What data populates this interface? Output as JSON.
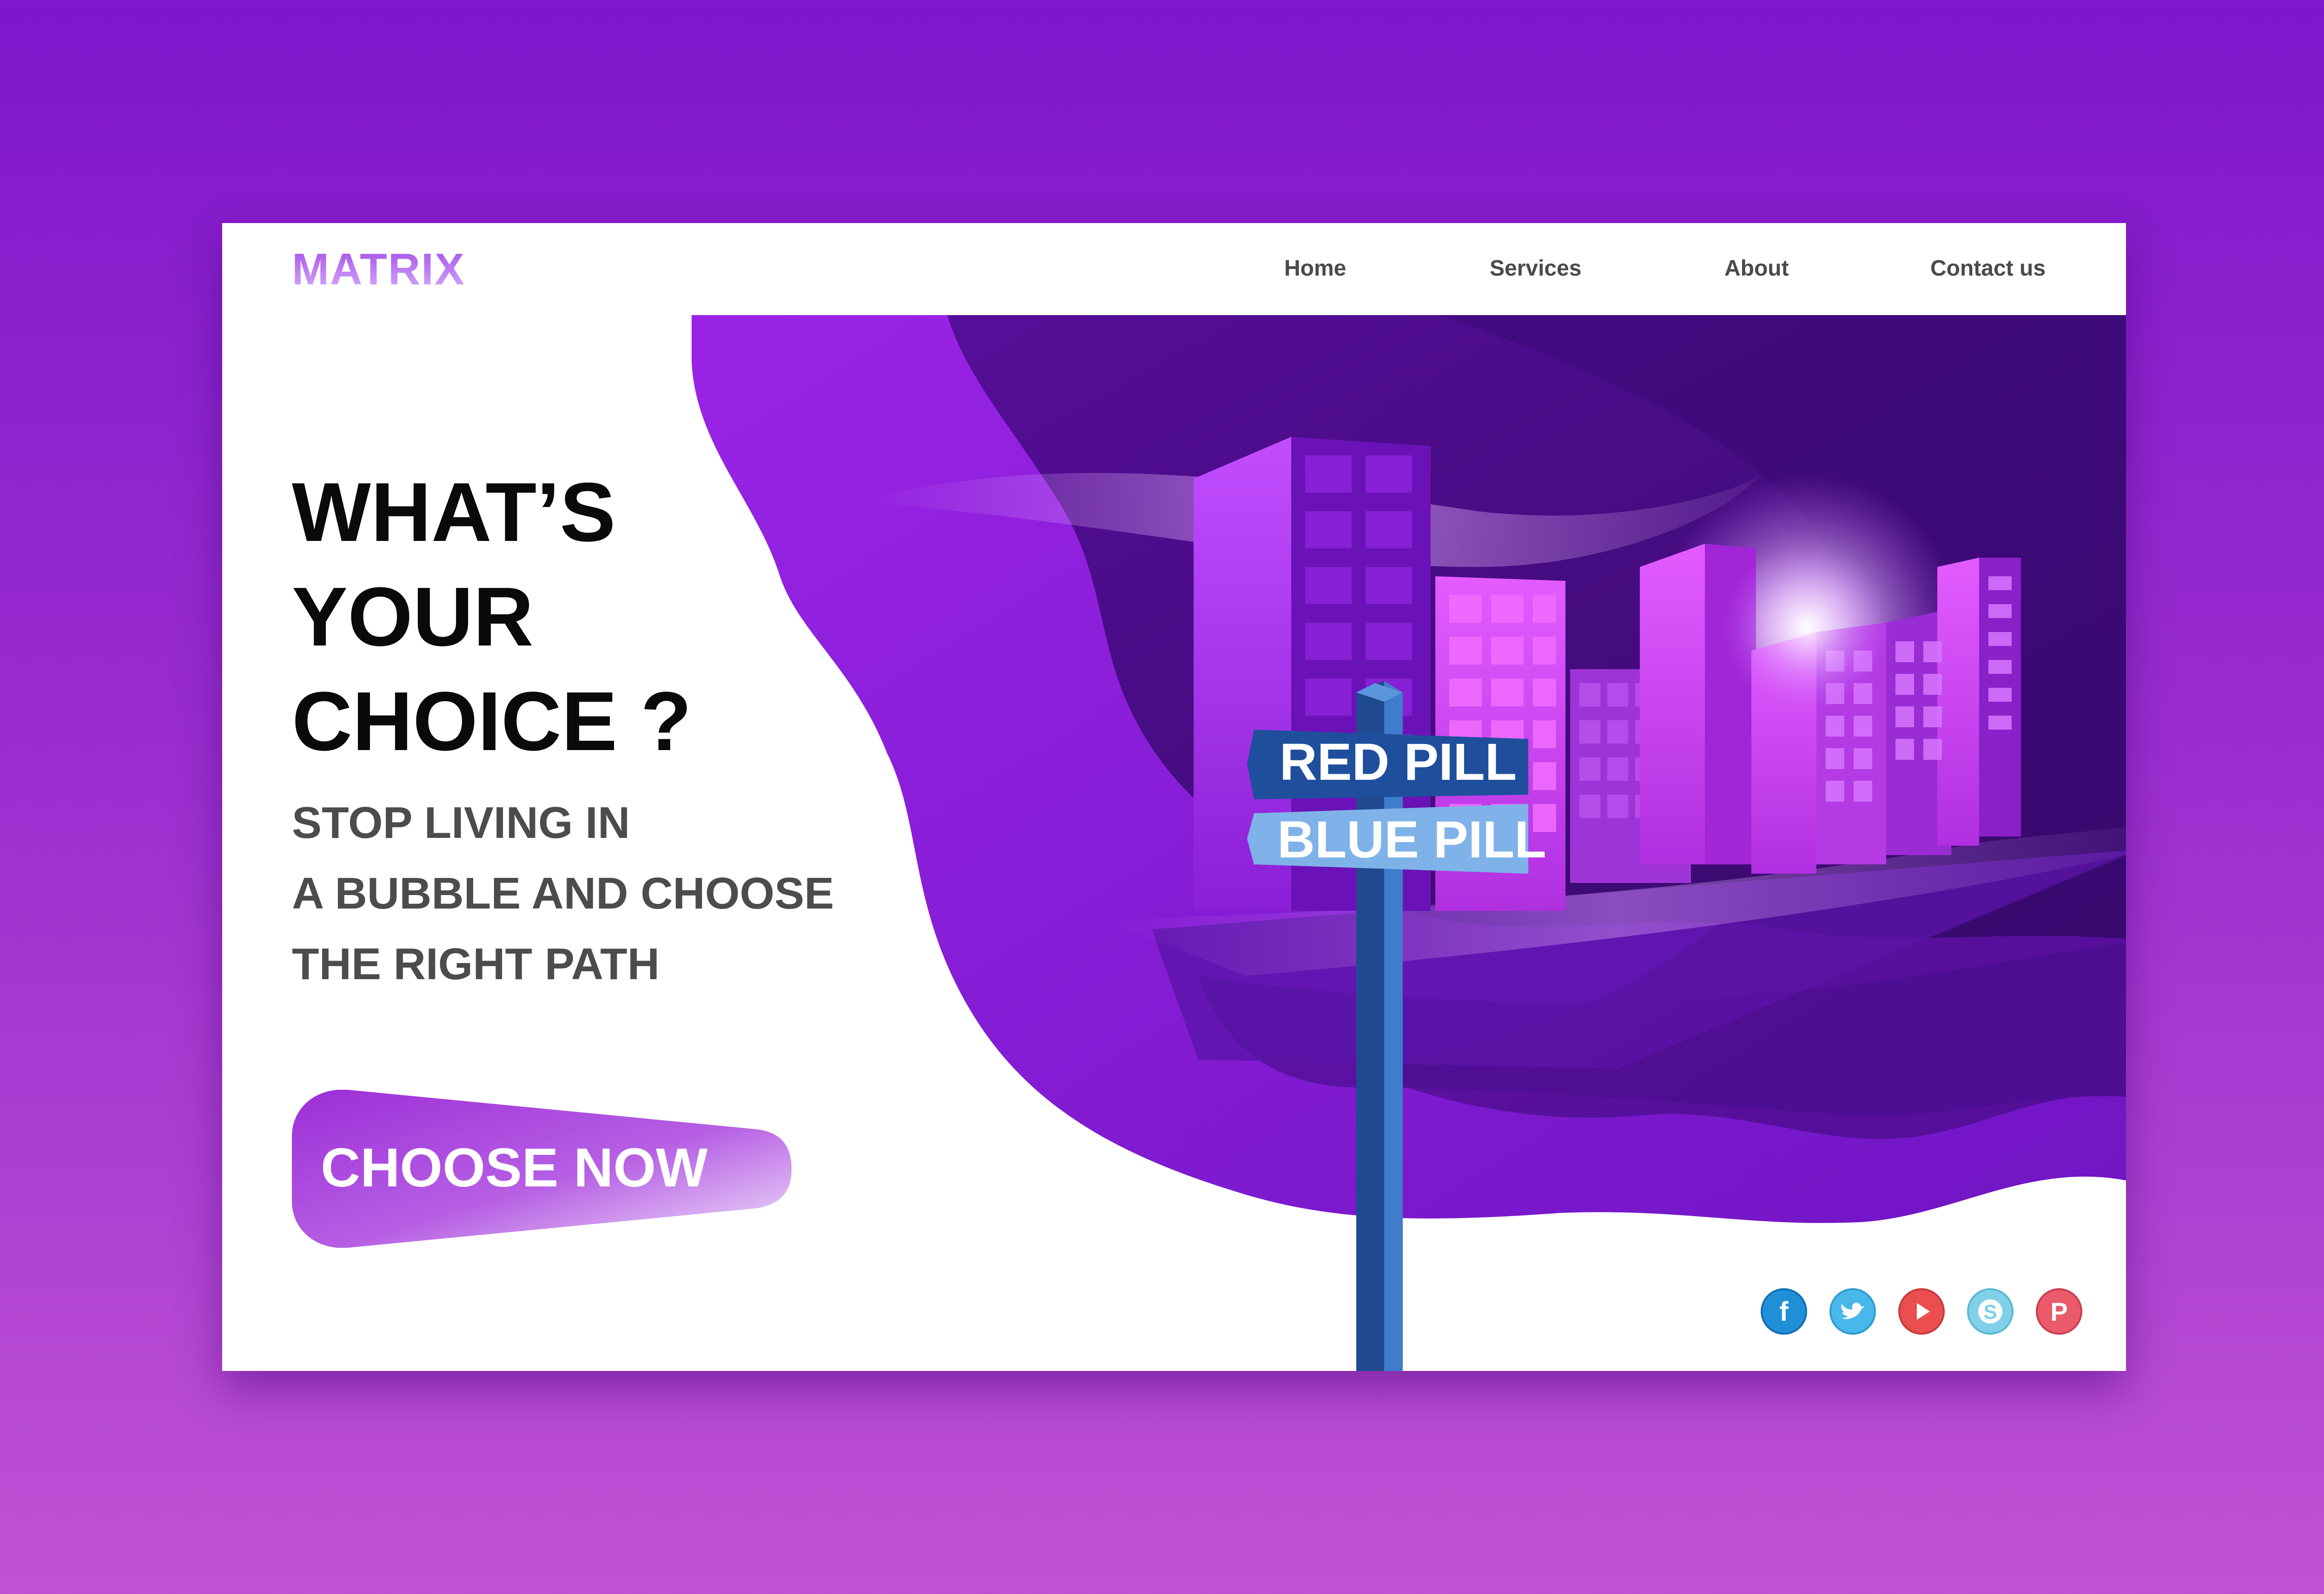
{
  "brand": {
    "logo_text": "MATRIX"
  },
  "nav": [
    {
      "label": "Home"
    },
    {
      "label": "Services"
    },
    {
      "label": "About"
    },
    {
      "label": "Contact us"
    }
  ],
  "hero": {
    "headline_lines": [
      "WHAT’S",
      "YOUR",
      "CHOICE ?"
    ],
    "subtext_lines": [
      "STOP LIVING IN",
      "A BUBBLE AND CHOOSE",
      "THE RIGHT PATH"
    ],
    "cta_label": "CHOOSE NOW"
  },
  "illustration": {
    "sign_top": "RED PILL",
    "sign_bottom": "BLUE PILL"
  },
  "social": [
    {
      "icon": "facebook-icon",
      "glyph": "f",
      "color": "#1f8fd8"
    },
    {
      "icon": "twitter-icon",
      "glyph": "",
      "color": "#48b8ea"
    },
    {
      "icon": "youtube-icon",
      "glyph": "",
      "color": "#ea4e4e"
    },
    {
      "icon": "skype-icon",
      "glyph": "S",
      "color": "#7fd0e8"
    },
    {
      "icon": "pinterest-icon",
      "glyph": "P",
      "color": "#ea5a6a"
    }
  ],
  "colors": {
    "background_top": "#7f16cc",
    "background_bottom": "#c052d4",
    "accent_purple": "#8a1fd6",
    "sign_top_color": "#1f4f9c",
    "sign_bottom_color": "#7fb2e8"
  }
}
